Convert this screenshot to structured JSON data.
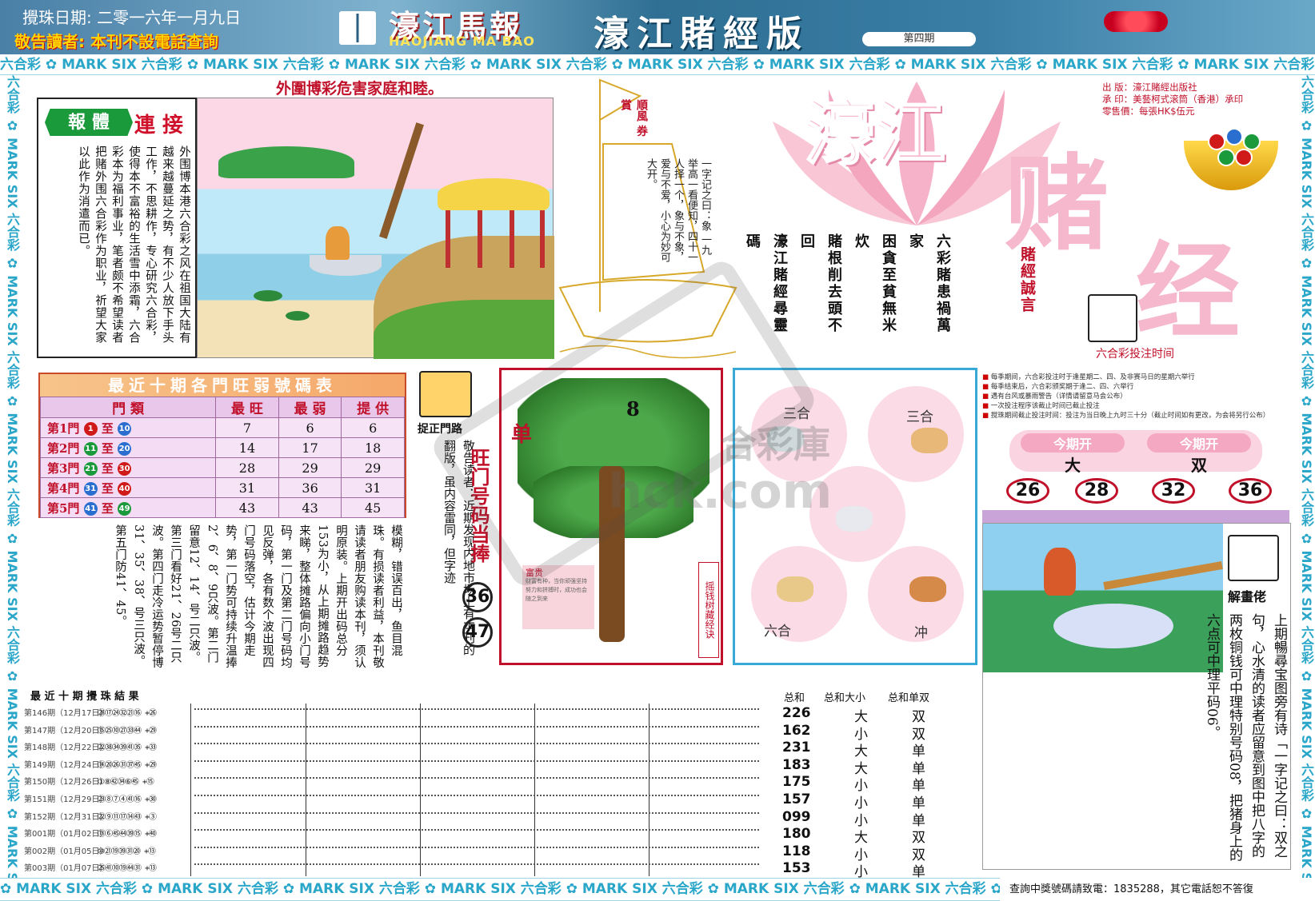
{
  "header": {
    "date": "攪珠日期: 二零一六年一月九日",
    "notice": "敬告讀者: 本刊不設電話查詢",
    "brand_cn": "濠江馬報",
    "brand_en": "HAOJIANG MA BAO",
    "edition": "濠江賭經版",
    "issue": "第四期"
  },
  "strip": {
    "top_text": "六合彩 ✿ MARK SIX 六合彩 ✿ MARK SIX 六合彩 ✿ MARK SIX 六合彩 ✿ MARK SIX 六合彩 ✿ MARK SIX 六合彩 ✿ MARK SIX 六合彩 ✿ MARK SIX 六合彩 ✿ MARK SIX 六合彩 ✿ MARK SIX 六合彩 ✿ MARK SIX",
    "side_text": "六合彩 ✿ MARK SIX 六合彩 ✿ MARK SIX 六合彩 ✿ MARK SIX 六合彩 ✿ MARK SIX 六合彩 ✿ MARK SIX 六合彩 ✿ MARK SIX 六合彩 ✿ MARK SIX",
    "bottom_text": "✿ MARK SIX 六合彩 ✿ MARK SIX 六合彩 ✿ MARK SIX 六合彩 ✿ MARK SIX 六合彩 ✿ MARK SIX 六合彩 ✿ MARK SIX 六合彩 ✿ MARK SIX 六合彩 ✿ MA"
  },
  "story": {
    "headline": "外圍博彩危害家庭和睦。",
    "tag1": "報 體",
    "tag2": "連 接",
    "text": "外围博本港六合彩之风在祖国大陆有越来越蔓延之势，有不少人放下手头工作，不思耕作，专心研究六合彩，使得本不富裕的生活雪中添霜，六合彩本为福利事业，笔者颇不希望读者把赌外围六合彩作为职业，祈望大家以此作为消遣而已。"
  },
  "sail": {
    "tag": "順風 券賞",
    "text": "一字记之曰：象 一九举高一看便知，四十一人择一个，象与不象，爱与不爱，小心为妙可大开。"
  },
  "logo": {
    "part1": "濠江",
    "part2": "赌",
    "part3": "经",
    "publisher": "出 版：濠江賭經出版社",
    "printer": "承 印：美藝柯式滚筒（香港）承印",
    "price": "零售價：每張HK$伍元"
  },
  "slogans": [
    "六彩賭患禍萬家",
    "困貪至貧無米炊",
    "賭根削去頭不回",
    "濠江賭經尋靈碼"
  ],
  "motto": "賭經誠言",
  "bet": {
    "label": "六合彩投注时间",
    "notes": [
      "每季期间，六合彩投注时于逢星期二、四、及非赛马日的星期六举行",
      "每季结束后，六合彩颁奖期于逢二、四、六举行",
      "遇有台风或暴雨警告（详情请留意马会公布）",
      "一次投注程序该截止时间已截止投注",
      "搅珠期间截止投注时间：投注为当日晚上九时三十分（截止时间如有更改，为会将另行公布）"
    ],
    "this_period_label": "今期开",
    "big_small": "大",
    "odd_even": "双",
    "numbers": [
      "26",
      "28",
      "32",
      "36"
    ]
  },
  "table": {
    "title": "最近十期各門旺弱號碼表",
    "headers": [
      "門 類",
      "最 旺",
      "最 弱",
      "提 供"
    ],
    "rows": [
      {
        "gate": "第1門",
        "from": "1",
        "to": "10",
        "fc": "#d01a1a",
        "tc": "#2a6fd0",
        "hot": "7",
        "cold": "6",
        "offer": "6"
      },
      {
        "gate": "第2門",
        "from": "11",
        "to": "20",
        "fc": "#1a9a3a",
        "tc": "#2a6fd0",
        "hot": "14",
        "cold": "17",
        "offer": "18"
      },
      {
        "gate": "第3門",
        "from": "21",
        "to": "30",
        "fc": "#1a9a3a",
        "tc": "#d01a1a",
        "hot": "28",
        "cold": "29",
        "offer": "29"
      },
      {
        "gate": "第4門",
        "from": "31",
        "to": "40",
        "fc": "#2a6fd0",
        "tc": "#d01a1a",
        "hot": "31",
        "cold": "36",
        "offer": "31"
      },
      {
        "gate": "第5門",
        "from": "41",
        "to": "49",
        "fc": "#2a6fd0",
        "tc": "#1a9a3a",
        "hot": "43",
        "cold": "43",
        "offer": "45"
      }
    ]
  },
  "catch_label": "捉正門路",
  "warning": "敬告读者：近期发现内地市场上有本刊的翻版，虽内容雷同，但字迹",
  "hot_label": "旺门号码当捧",
  "hot_numbers": [
    "36",
    "47"
  ],
  "paragraph": "模糊，错误百出，鱼目混珠。有损读者利益，本刊敬请读者朋友购读本刊，须认明原装。上期开出码总分153为小，从上期摊路趋势来睇，整体摊路偏向小门号码，第一门及第二门号码均见反弹，各有数个波出现四门号码落空，估计今期走势，第一门势可持续升温捧2、6、8、9只波。第二门留意12、14、号二只波。第三门看好21、26号二只波。第四门走冷运势暂停博31、35、38、号三只波。第五门防41、45。",
  "tree": {
    "left_char": "单",
    "number": "8",
    "side_label": "摇钱树藏经诀",
    "card_title": "富贵",
    "card_text": "财富有种，当你顽强坚持努力和拼搏时，成功也会随之到来"
  },
  "zodiac": {
    "tl": "三合",
    "tr": "三合",
    "bl": "六合",
    "br": "冲"
  },
  "records": {
    "head": "最 近 十 期 攪 珠 結 果",
    "rows": [
      {
        "label": "第146期（12月17日）",
        "nums": "㉘⑰㉔㉜㉑⑯ +㉖"
      },
      {
        "label": "第147期（12月20日）",
        "nums": "⑮㉕⑩㉗㉝㊹ +㉙"
      },
      {
        "label": "第148期（12月22日）",
        "nums": "㉒㊳㉞㊴㊶㉟ +㉝"
      },
      {
        "label": "第149期（12月24日）",
        "nums": "⑭⑳㉖㉛㊲㊺ +㉙"
      },
      {
        "label": "第150期（12月26日）",
        "nums": "①⑧㊷㉞⑥㊺ +⑮"
      },
      {
        "label": "第151期（12月29日）",
        "nums": "㉓⑧⑦④㊶⑯ +㉚"
      },
      {
        "label": "第152期（12月31日）",
        "nums": "㉒⑨⑪⑰⑭㊸ +③"
      },
      {
        "label": "第001期（01月02日）",
        "nums": "⑬⑥㊺㊹㊴⑮ +㊵"
      },
      {
        "label": "第002期（01月05日）",
        "nums": "⑩㉑⑲㊴㉛⑳ +⑬"
      },
      {
        "label": "第003期（01月07日）",
        "nums": "㉕㊶⑩⑲㊹㉛ +⑬"
      }
    ]
  },
  "sums": {
    "head1": "总和",
    "head2": "总和大小",
    "head3": "总和单双",
    "rows": [
      {
        "s": "226",
        "b": "大",
        "o": "双"
      },
      {
        "s": "162",
        "b": "小",
        "o": "双"
      },
      {
        "s": "231",
        "b": "大",
        "o": "单"
      },
      {
        "s": "183",
        "b": "大",
        "o": "单"
      },
      {
        "s": "175",
        "b": "小",
        "o": "单"
      },
      {
        "s": "157",
        "b": "小",
        "o": "单"
      },
      {
        "s": "099",
        "b": "小",
        "o": "单"
      },
      {
        "s": "180",
        "b": "大",
        "o": "双"
      },
      {
        "s": "118",
        "b": "小",
        "o": "双"
      },
      {
        "s": "153",
        "b": "小",
        "o": "单"
      }
    ]
  },
  "right": {
    "label": "解畫佬",
    "text": "上期暢尋宝图旁有诗「一字记之曰：双之句，心水清的读者应留意到图中把八字的两枚铜钱可中理特别号码08，把猪身上的六点可中理平码06。"
  },
  "contact": "查詢中獎號碼請致電：1835288，其它電話恕不答復",
  "watermark": {
    "cn": "合彩庫",
    "en": "hck.com"
  }
}
